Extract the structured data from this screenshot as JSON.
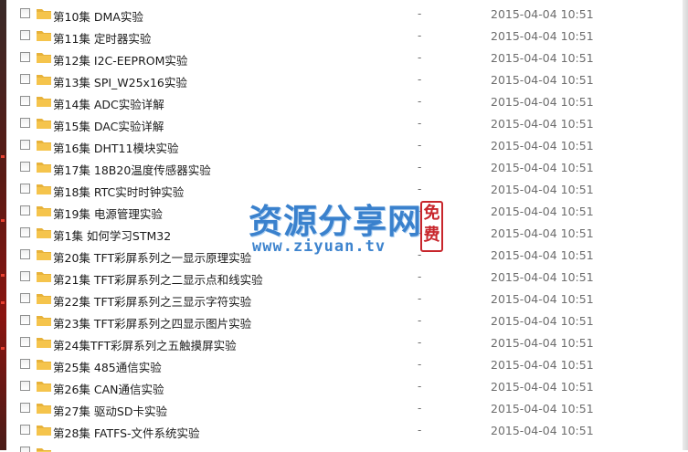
{
  "rows": [
    {
      "name": "第10集 DMA实验",
      "size": "-",
      "date": "2015-04-04 10:51"
    },
    {
      "name": "第11集 定时器实验",
      "size": "-",
      "date": "2015-04-04 10:51"
    },
    {
      "name": "第12集 I2C-EEPROM实验",
      "size": "-",
      "date": "2015-04-04 10:51"
    },
    {
      "name": "第13集 SPI_W25x16实验",
      "size": "-",
      "date": "2015-04-04 10:51"
    },
    {
      "name": "第14集 ADC实验详解",
      "size": "-",
      "date": "2015-04-04 10:51"
    },
    {
      "name": "第15集 DAC实验详解",
      "size": "-",
      "date": "2015-04-04 10:51"
    },
    {
      "name": "第16集 DHT11模块实验",
      "size": "-",
      "date": "2015-04-04 10:51"
    },
    {
      "name": "第17集 18B20温度传感器实验",
      "size": "-",
      "date": "2015-04-04 10:51"
    },
    {
      "name": "第18集 RTC实时时钟实验",
      "size": "-",
      "date": "2015-04-04 10:51"
    },
    {
      "name": "第19集 电源管理实验",
      "size": "-",
      "date": "2015-04-04 10:51"
    },
    {
      "name": "第1集 如何学习STM32",
      "size": "-",
      "date": "2015-04-04 10:51"
    },
    {
      "name": "第20集 TFT彩屏系列之一显示原理实验",
      "size": "-",
      "date": "2015-04-04 10:51"
    },
    {
      "name": "第21集 TFT彩屏系列之二显示点和线实验",
      "size": "-",
      "date": "2015-04-04 10:51"
    },
    {
      "name": "第22集 TFT彩屏系列之三显示字符实验",
      "size": "-",
      "date": "2015-04-04 10:51"
    },
    {
      "name": "第23集 TFT彩屏系列之四显示图片实验",
      "size": "-",
      "date": "2015-04-04 10:51"
    },
    {
      "name": "第24集TFT彩屏系列之五触摸屏实验",
      "size": "-",
      "date": "2015-04-04 10:51"
    },
    {
      "name": "第25集 485通信实验",
      "size": "-",
      "date": "2015-04-04 10:51"
    },
    {
      "name": "第26集 CAN通信实验",
      "size": "-",
      "date": "2015-04-04 10:51"
    },
    {
      "name": "第27集 驱动SD卡实验",
      "size": "-",
      "date": "2015-04-04 10:51"
    },
    {
      "name": "第28集 FATFS-文件系统实验",
      "size": "-",
      "date": "2015-04-04 10:51"
    }
  ],
  "watermark": {
    "title": "资源分享网",
    "url": "www.ziyuan.tv",
    "seal": [
      "免",
      "费"
    ]
  },
  "colors": {
    "folder": "#f5c44c",
    "watermark_blue": "#2a77c9",
    "seal_red": "#c8262c"
  },
  "icons": {
    "row_icon": "folder-icon",
    "row_check": "checkbox"
  }
}
